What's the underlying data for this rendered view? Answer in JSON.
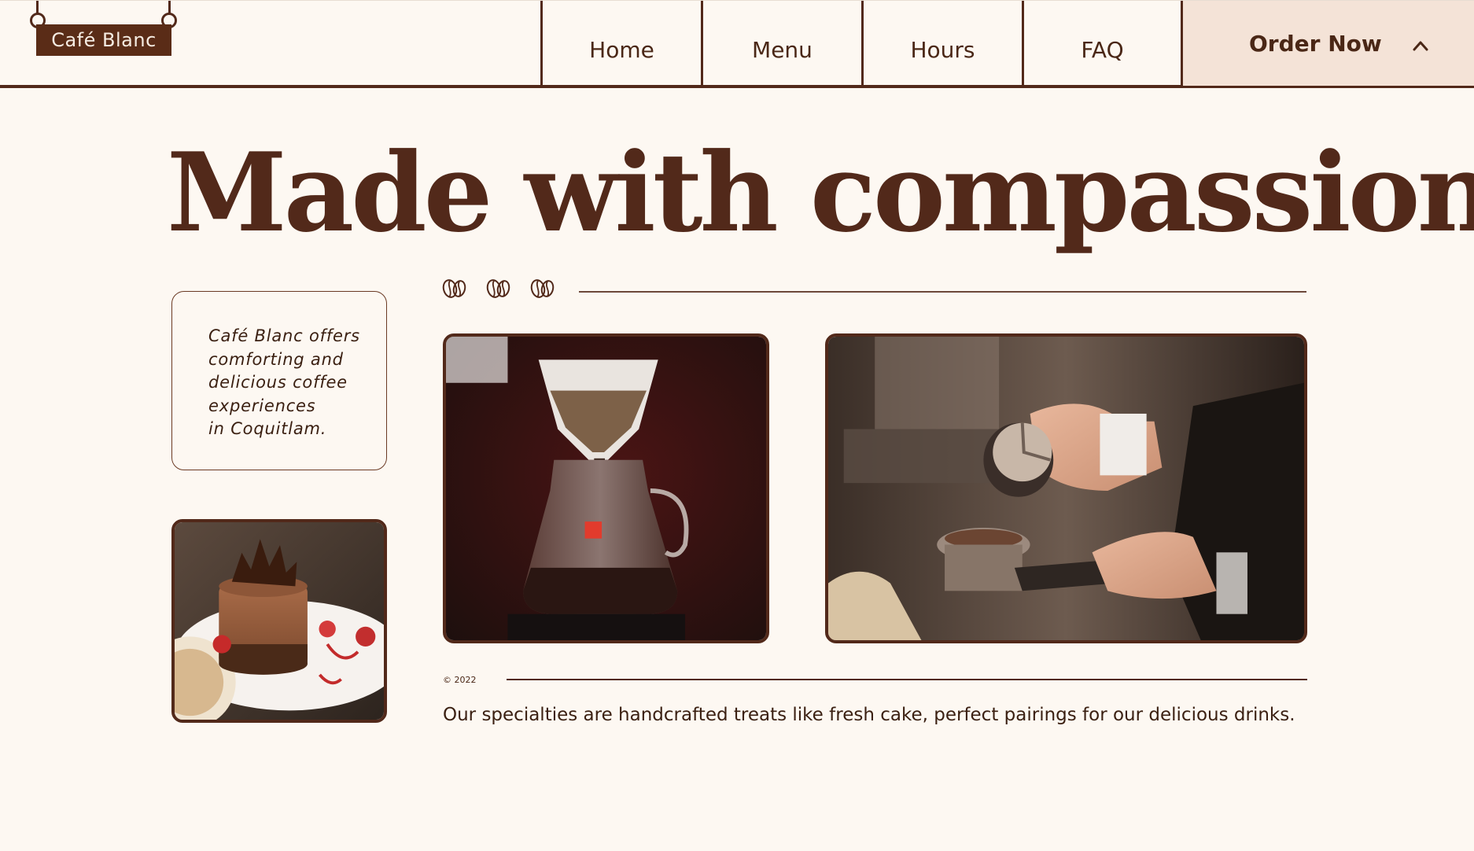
{
  "brand": {
    "name": "Café Blanc"
  },
  "nav": {
    "items": [
      {
        "label": "Home"
      },
      {
        "label": "Menu"
      },
      {
        "label": "Hours"
      },
      {
        "label": "FAQ"
      }
    ],
    "order_label": "Order Now",
    "order_icon": "chevron-up-icon"
  },
  "hero": {
    "title": "Made with compassion.",
    "blurb_lines": [
      "Café Blanc offers",
      "comforting and",
      "delicious coffee",
      "experiences",
      "in Coquitlam."
    ],
    "decor_icons": [
      "coffee-bean-icon",
      "coffee-bean-icon",
      "coffee-bean-icon"
    ]
  },
  "photos": {
    "cake": "chocolate-mousse-cake-photo",
    "pour_over": "pour-over-coffee-photo",
    "espresso": "espresso-tamping-photo"
  },
  "footer": {
    "copyright": "© 2022",
    "caption": "Our specialties are handcrafted treats like fresh cake, perfect pairings for our delicious drinks."
  },
  "colors": {
    "background": "#fdf8f2",
    "brand_brown": "#52291a",
    "order_bg": "#f4e3d7",
    "text": "#4a2716"
  }
}
